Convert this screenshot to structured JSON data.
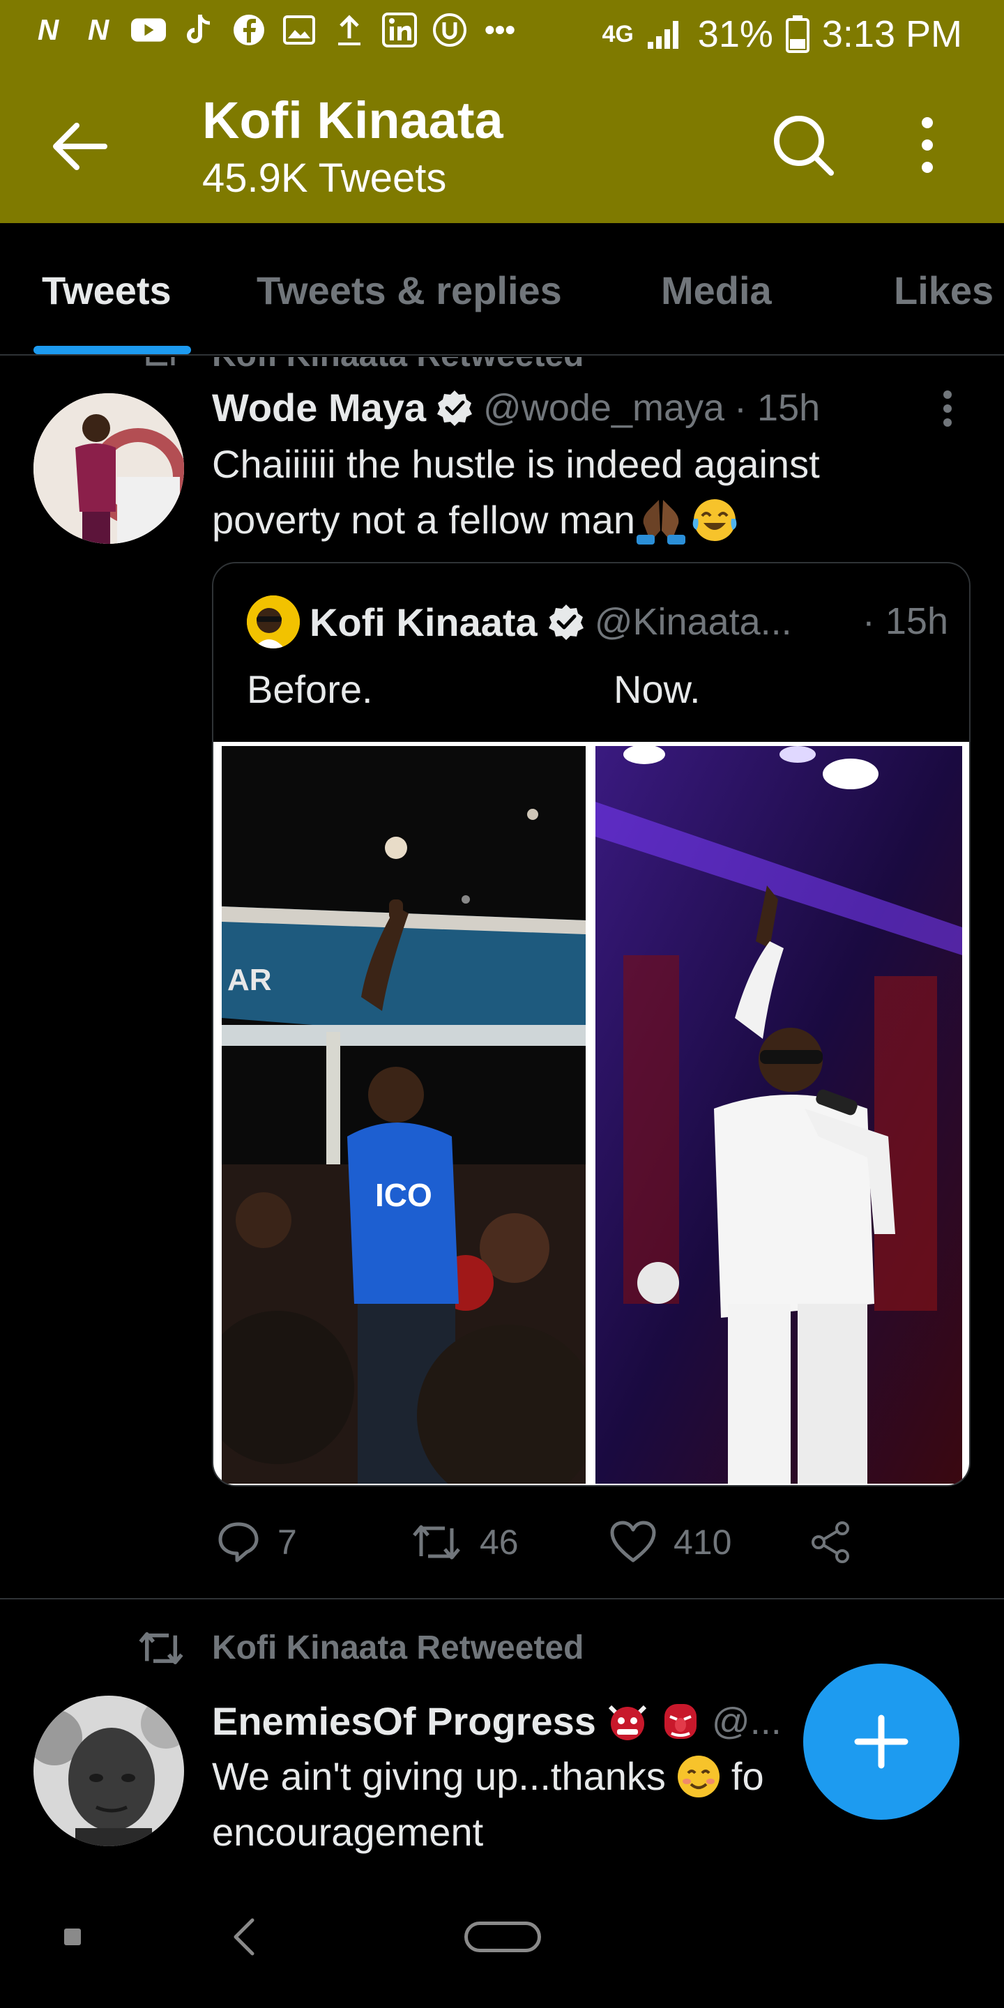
{
  "status_bar": {
    "left_icons": [
      "network-n-icon",
      "network-n-icon",
      "youtube-icon",
      "tiktok-icon",
      "facebook-icon",
      "gallery-icon",
      "upload-icon",
      "linkedin-icon",
      "app-icon",
      "more-dots-icon"
    ],
    "network": "4G",
    "battery": "31%",
    "time": "3:13 PM"
  },
  "header": {
    "title": "Kofi Kinaata",
    "subtitle": "45.9K Tweets",
    "bg_color": "#7f7a00"
  },
  "tabs": [
    {
      "label": "Tweets",
      "active": true
    },
    {
      "label": "Tweets & replies",
      "active": false
    },
    {
      "label": "Media",
      "active": false
    },
    {
      "label": "Likes",
      "active": false
    }
  ],
  "tweets": [
    {
      "retweet_label": "Kofi Kinaata Retweeted",
      "author_name": "Wode Maya",
      "verified": true,
      "handle": "@wode_maya",
      "time": "· 15h",
      "text_line1": "Chaiiiiii the hustle is indeed against",
      "text_line2": "poverty not a fellow man",
      "emojis": [
        "folded-hands-icon",
        "tears-of-joy-icon"
      ],
      "quote": {
        "author_name": "Kofi Kinaata",
        "verified": true,
        "handle": "@Kinaata...",
        "time": "· 15h",
        "caption_left": "Before.",
        "caption_right": "Now."
      },
      "replies": "7",
      "retweets": "46",
      "likes": "410"
    },
    {
      "retweet_label": "Kofi Kinaata Retweeted",
      "author_name": "EnemiesOf Progress",
      "name_emojis": [
        "ogre-icon",
        "goblin-icon"
      ],
      "handle": "@...",
      "text_line1": "We ain't giving up...thanks",
      "text_line1_end": "fo",
      "text_line2": "encouragement"
    }
  ],
  "colors": {
    "accent": "#1d9bf0",
    "header": "#7f7a00",
    "verified_badge": "#e7e9ea"
  }
}
